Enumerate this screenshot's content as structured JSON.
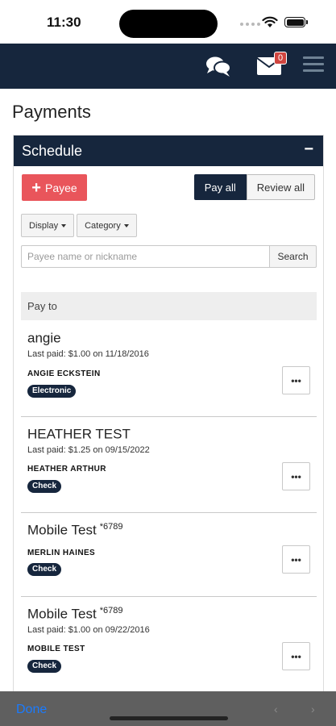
{
  "status_bar": {
    "time": "11:30"
  },
  "header": {
    "mail_badge": "0"
  },
  "page": {
    "title": "Payments"
  },
  "panel": {
    "title": "Schedule",
    "collapse_label": "−",
    "add_payee_label": "Payee",
    "pay_all_label": "Pay all",
    "review_all_label": "Review all",
    "display_label": "Display",
    "category_label": "Category",
    "search_placeholder": "Payee name or nickname",
    "search_button_label": "Search",
    "pay_to_label": "Pay to"
  },
  "payees": [
    {
      "name": "angie",
      "account": "",
      "last_paid": "Last paid: $1.00 on 11/18/2016",
      "nickname": "ANGIE ECKSTEIN",
      "type": "Electronic"
    },
    {
      "name": "HEATHER TEST",
      "account": "",
      "last_paid": "Last paid: $1.25 on 09/15/2022",
      "nickname": "HEATHER ARTHUR",
      "type": "Check"
    },
    {
      "name": "Mobile Test",
      "account": "*6789",
      "last_paid": "",
      "nickname": "MERLIN HAINES",
      "type": "Check"
    },
    {
      "name": "Mobile Test",
      "account": "*6789",
      "last_paid": "Last paid: $1.00 on 09/22/2016",
      "nickname": "MOBILE TEST",
      "type": "Check"
    }
  ],
  "more_label": "•••",
  "toolbar": {
    "done_label": "Done"
  },
  "colors": {
    "navy": "#16263d",
    "accent_red": "#e9555b",
    "badge_red": "#d0453f",
    "link_blue": "#1a7bff"
  },
  "icons": [
    "chat-icon",
    "mail-icon",
    "menu-icon",
    "plus-icon",
    "caret-down-icon",
    "more-icon",
    "wifi-icon",
    "battery-icon"
  ]
}
